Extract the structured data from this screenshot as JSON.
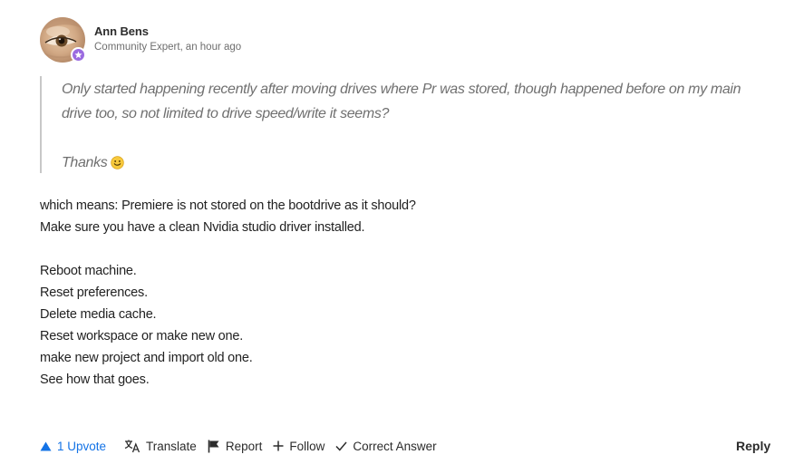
{
  "author": {
    "name": "Ann Bens",
    "role": "Community Expert",
    "time": "an hour ago",
    "badge_color": "#9b6be0"
  },
  "quote": {
    "line1": "Only started happening recently after moving drives where Pr was stored, though happened before on my main",
    "line2": "drive too, so not limited to drive speed/write it seems?",
    "thanks": "Thanks",
    "emoji_icon": "smiley-icon"
  },
  "body": {
    "lines": [
      "which means: Premiere is not stored on the bootdrive as it should?",
      "Make sure you have a clean Nvidia studio driver installed.",
      "Reboot machine.",
      "Reset preferences.",
      "Delete media cache.",
      "Reset workspace or make new one.",
      "make new project and import old one.",
      "See how that goes."
    ]
  },
  "actions": {
    "upvote_label": "1 Upvote",
    "translate_label": "Translate",
    "report_label": "Report",
    "follow_label": "Follow",
    "correct_label": "Correct Answer",
    "reply_label": "Reply",
    "accent_color": "#1473e6"
  }
}
